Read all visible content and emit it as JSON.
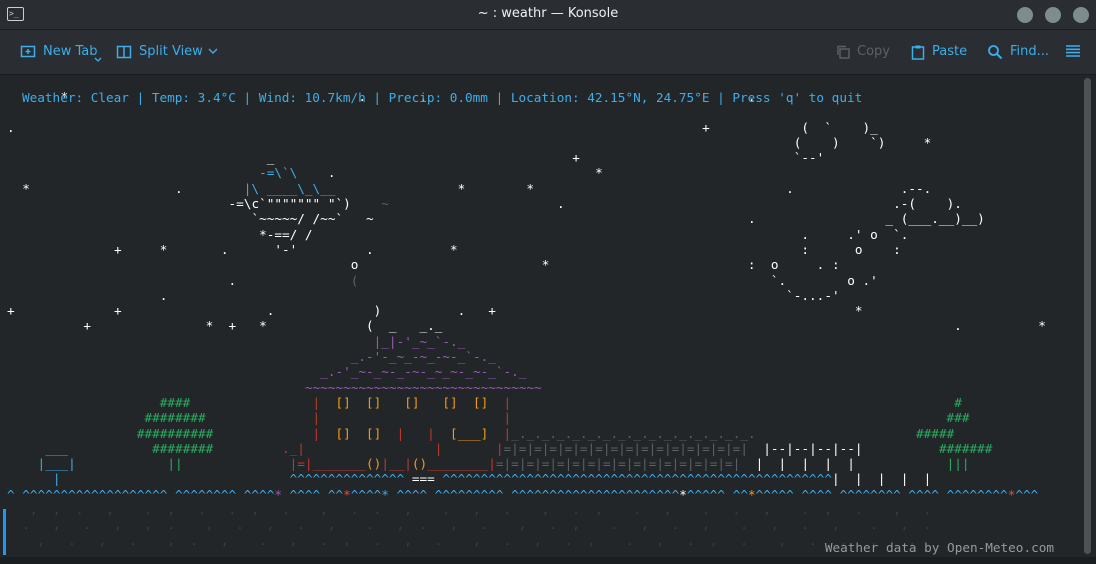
{
  "window": {
    "title": "~ : weathr — Konsole"
  },
  "toolbar": {
    "new_tab": "New Tab",
    "split_view": "Split View",
    "copy": "Copy",
    "paste": "Paste",
    "find": "Find..."
  },
  "terminal": {
    "status_line": "Weather: Clear | Temp: 3.4°C | Wind: 10.7km/h | Precip: 0.0mm | Location: 42.15°N, 24.75°E | Press 'q' to quit",
    "credit": "Weather data by Open-Meteo.com"
  },
  "colors": {
    "accent": "#3daee9",
    "window_bg": "#232629",
    "chrome_bg": "#2a2e32",
    "sky_text": "#ffffff",
    "airplane": "#3daee9",
    "roof": "#9b59b6",
    "windows": "#f39c12",
    "house_wall": "#c0392b",
    "trees": "#27ae60",
    "ground": "#3daee9",
    "flower_red": "#e74c3c"
  },
  "icons": {
    "app": "terminal-icon",
    "new_tab": "new-tab-icon",
    "split_view": "split-view-icon",
    "copy": "copy-icon",
    "paste": "paste-icon",
    "find": "search-icon",
    "menu": "hamburger-menu-icon"
  }
}
